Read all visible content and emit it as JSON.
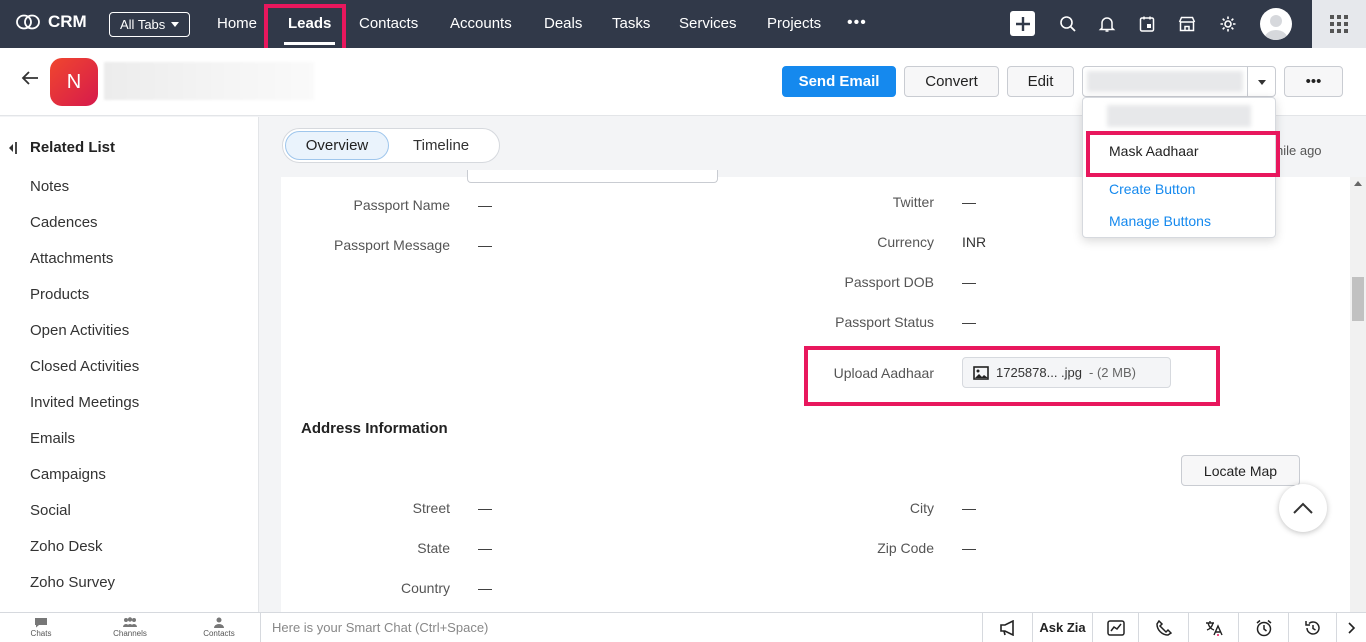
{
  "app": {
    "name": "CRM",
    "all_tabs_label": "All Tabs"
  },
  "nav": {
    "tabs": [
      "Home",
      "Leads",
      "Contacts",
      "Accounts",
      "Deals",
      "Tasks",
      "Services",
      "Projects"
    ],
    "active_tab": "Leads",
    "more_label": "•••"
  },
  "record": {
    "avatar_initial": "N",
    "buttons": {
      "send_email": "Send Email",
      "convert": "Convert",
      "edit": "Edit",
      "more": "•••"
    }
  },
  "dropdown": {
    "items": [
      "Mask Aadhaar",
      "Create Button",
      "Manage Buttons"
    ]
  },
  "sidebar": {
    "heading": "Related List",
    "items": [
      "Notes",
      "Cadences",
      "Attachments",
      "Products",
      "Open Activities",
      "Closed Activities",
      "Invited Meetings",
      "Emails",
      "Campaigns",
      "Social",
      "Zoho Desk",
      "Zoho Survey"
    ]
  },
  "view_tabs": {
    "overview": "Overview",
    "timeline": "Timeline",
    "modified_suffix": "hile ago"
  },
  "fields": {
    "passport_name": {
      "label": "Passport Name",
      "value": "—"
    },
    "passport_message": {
      "label": "Passport Message",
      "value": "—"
    },
    "twitter": {
      "label": "Twitter",
      "value": "—"
    },
    "currency": {
      "label": "Currency",
      "value": "INR"
    },
    "passport_dob": {
      "label": "Passport DOB",
      "value": "—"
    },
    "passport_status": {
      "label": "Passport Status",
      "value": "—"
    },
    "upload_aadhaar": {
      "label": "Upload Aadhaar",
      "file_name": "1725878... .jpg",
      "file_size": "- (2 MB)"
    }
  },
  "address": {
    "heading": "Address Information",
    "locate_map": "Locate Map",
    "street": {
      "label": "Street",
      "value": "—"
    },
    "city": {
      "label": "City",
      "value": "—"
    },
    "state": {
      "label": "State",
      "value": "—"
    },
    "zip": {
      "label": "Zip Code",
      "value": "—"
    },
    "country": {
      "label": "Country",
      "value": "—"
    }
  },
  "bottom": {
    "tabs": [
      "Chats",
      "Channels",
      "Contacts"
    ],
    "smart_chat_placeholder": "Here is your Smart Chat (Ctrl+Space)",
    "ask_zia": "Ask Zia"
  },
  "colors": {
    "topbar": "#313949",
    "accent_blue": "#1589ee",
    "highlight": "#e8175d"
  }
}
